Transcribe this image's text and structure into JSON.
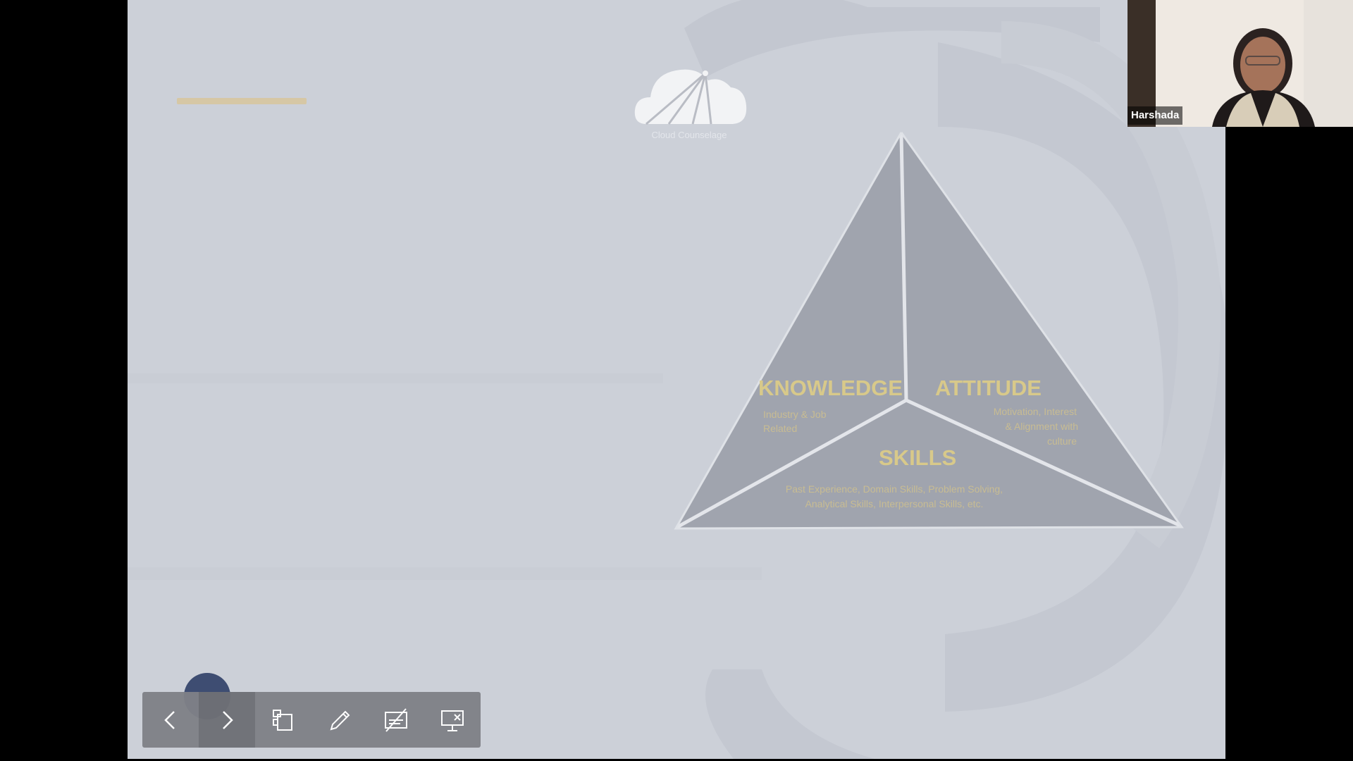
{
  "slide": {
    "logo_text": "Cloud Counselage",
    "triangle": {
      "knowledge": {
        "title": "KNOWLEDGE",
        "desc_line1": "Industry & Job",
        "desc_line2": "Related"
      },
      "attitude": {
        "title": "ATTITUDE",
        "desc_line1": "Motivation, Interest",
        "desc_line2": "& Alignment with",
        "desc_line3": "culture"
      },
      "skills": {
        "title": "SKILLS",
        "desc_line1": "Past Experience, Domain Skills, Problem Solving,",
        "desc_line2": "Analytical Skills, Interpersonal Skills, etc."
      }
    }
  },
  "toolbar": {
    "items": [
      {
        "name": "previous-slide",
        "icon": "chevron-left-icon"
      },
      {
        "name": "next-slide",
        "icon": "chevron-right-icon"
      },
      {
        "name": "see-all-slides",
        "icon": "slides-grid-icon"
      },
      {
        "name": "pen-tool",
        "icon": "pen-icon"
      },
      {
        "name": "subtitles",
        "icon": "subtitles-off-icon"
      },
      {
        "name": "end-presentation",
        "icon": "screen-close-icon"
      }
    ]
  },
  "participant": {
    "name": "Harshada"
  },
  "colors": {
    "slide_bg": "#ccd0d8",
    "triangle_fill": "#9fa3ad",
    "label_gold": "#d8c98a",
    "toolbar_bg": "#7f8187"
  }
}
